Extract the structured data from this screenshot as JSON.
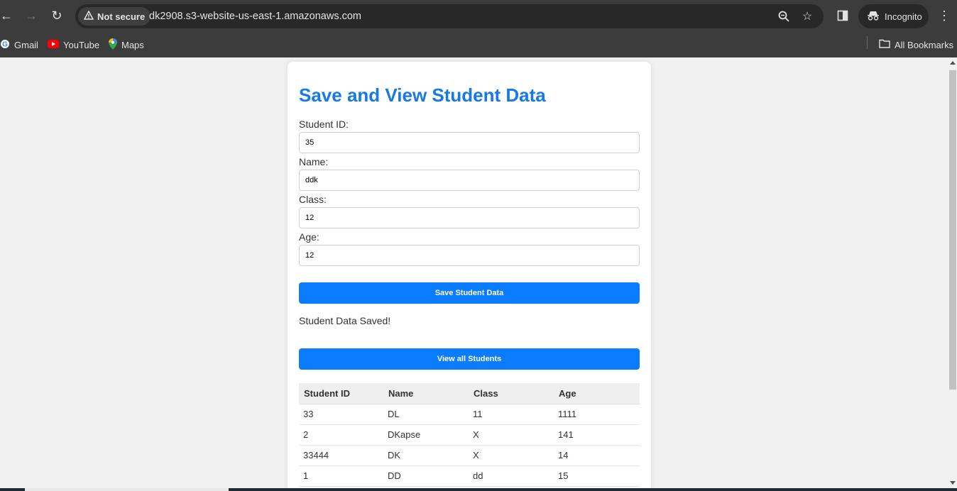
{
  "browser": {
    "security_label": "Not secure",
    "url": "dk2908.s3-website-us-east-1.amazonaws.com",
    "incognito_label": "Incognito",
    "bookmarks": [
      {
        "label": "Gmail",
        "icon": "google-icon"
      },
      {
        "label": "YouTube",
        "icon": "youtube-icon"
      },
      {
        "label": "Maps",
        "icon": "maps-icon"
      }
    ],
    "all_bookmarks_label": "All Bookmarks"
  },
  "page": {
    "title": "Save and View Student Data",
    "form": {
      "student_id_label": "Student ID:",
      "student_id_value": "35",
      "name_label": "Name:",
      "name_value": "ddk",
      "class_label": "Class:",
      "class_value": "12",
      "age_label": "Age:",
      "age_value": "12"
    },
    "save_button_label": "Save Student Data",
    "status_message": "Student Data Saved!",
    "view_button_label": "View all Students",
    "table": {
      "headers": [
        "Student ID",
        "Name",
        "Class",
        "Age"
      ],
      "rows": [
        [
          "33",
          "DL",
          "11",
          "1111"
        ],
        [
          "2",
          "DKapse",
          "X",
          "141"
        ],
        [
          "33444",
          "DK",
          "X",
          "14"
        ],
        [
          "1",
          "DD",
          "dd",
          "15"
        ]
      ]
    }
  },
  "colors": {
    "accent": "#0b7bff",
    "title": "#1579e6",
    "chrome": "#3c3c3c"
  }
}
